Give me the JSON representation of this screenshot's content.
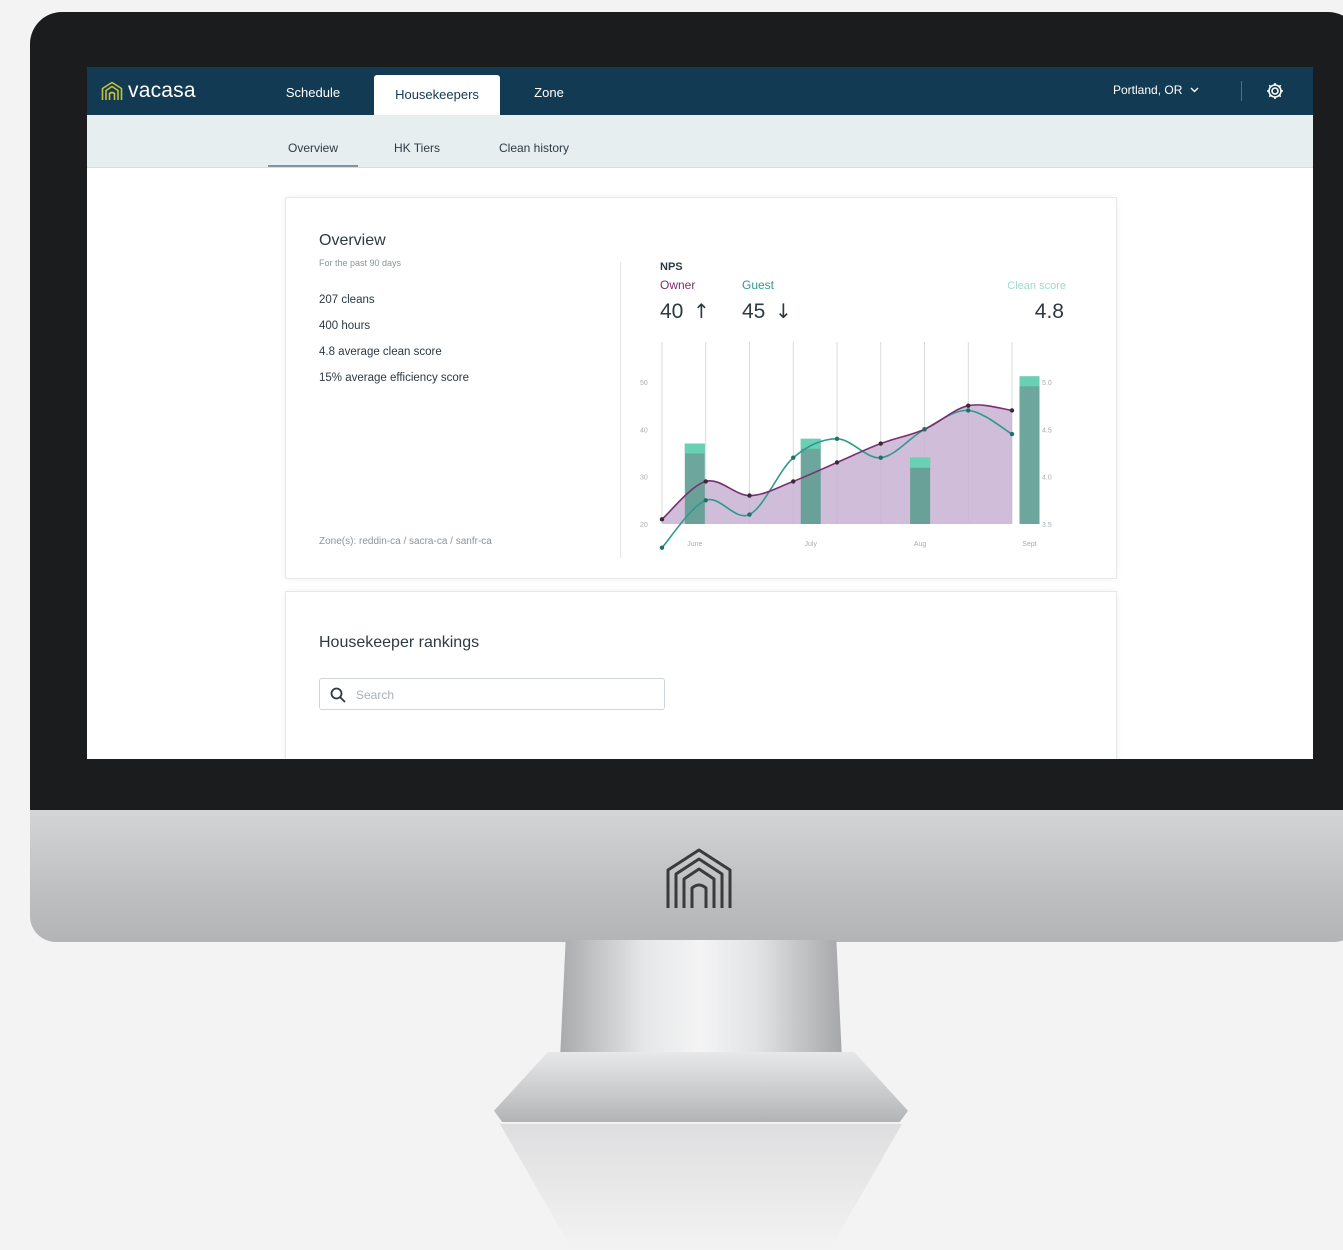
{
  "header": {
    "brand": "vacasa",
    "tabs": [
      {
        "label": "Schedule",
        "active": false
      },
      {
        "label": "Housekeepers",
        "active": true
      },
      {
        "label": "Zone",
        "active": false
      }
    ],
    "location": "Portland, OR"
  },
  "subnav": {
    "tabs": [
      {
        "label": "Overview",
        "active": true
      },
      {
        "label": "HK Tiers",
        "active": false
      },
      {
        "label": "Clean history",
        "active": false
      }
    ]
  },
  "overview": {
    "title": "Overview",
    "subtitle": "For the past 90 days",
    "stats": [
      "207 cleans",
      "400 hours",
      "4.8 average clean score",
      "15% average efficiency score"
    ],
    "zones": "Zone(s): reddin-ca / sacra-ca / sanfr-ca"
  },
  "chart_data": {
    "type": "line",
    "title": "NPS",
    "kpis": {
      "owner": {
        "label": "Owner",
        "value": "40",
        "trend": "↑"
      },
      "guest": {
        "label": "Guest",
        "value": "45",
        "trend": "↓"
      },
      "clean_score": {
        "label": "Clean score",
        "value": "4.8"
      }
    },
    "x_labels": [
      "June",
      "July",
      "Aug",
      "Sept"
    ],
    "y_left_ticks": [
      "50",
      "40",
      "30",
      "20"
    ],
    "y_right_ticks": [
      "5.0",
      "4.5",
      "4.0",
      "3.5"
    ],
    "ylim_left": [
      15,
      55
    ],
    "ylim_right": [
      3.25,
      5.25
    ],
    "x_points": [
      0,
      1,
      2,
      3,
      4,
      5,
      6,
      7,
      8
    ],
    "series": [
      {
        "name": "Owner",
        "color": "#7b2f6f",
        "values": [
          21,
          29,
          26,
          29,
          33,
          37,
          40,
          45,
          44
        ]
      },
      {
        "name": "Guest",
        "color": "#2e9a8f",
        "values": [
          15,
          25,
          22,
          34,
          38,
          34,
          40,
          44,
          39
        ]
      }
    ],
    "bars": {
      "name": "Clean score",
      "color_fill": "#5f9e94",
      "color_top": "#69d1b3",
      "positions": [
        0.75,
        3.4,
        5.9,
        8.4
      ],
      "values": [
        4.35,
        4.4,
        4.2,
        5.06
      ]
    },
    "colors": {
      "fill": "#c8b2d3",
      "grid": "#cfd3d6",
      "tick": "#a7aeb3"
    }
  },
  "rankings": {
    "title": "Housekeeper rankings",
    "search_placeholder": "Search"
  },
  "icons": {
    "brand": "house-logo-icon",
    "dropdown": "chevron-down-icon",
    "settings": "gear-icon",
    "search": "search-icon",
    "hardware_logo": "house-logo-icon"
  }
}
